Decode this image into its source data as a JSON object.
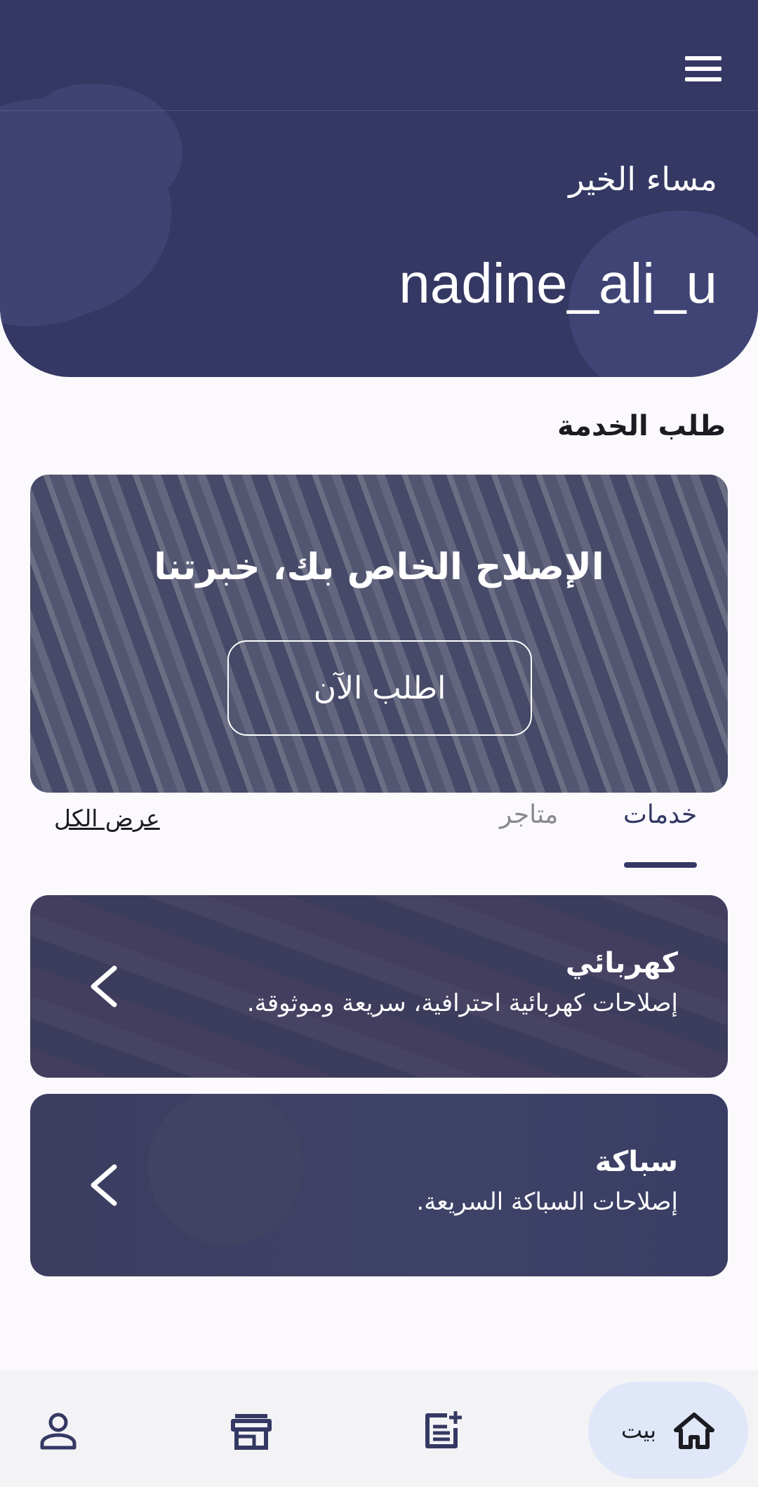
{
  "header": {
    "greeting": "مساء الخير",
    "username": "nadine_ali_u"
  },
  "section_title": "طلب الخدمة",
  "hero": {
    "title": "الإصلاح الخاص بك، خبرتنا",
    "button_label": "اطلب الآن"
  },
  "tabs": {
    "services": "خدمات",
    "stores": "متاجر",
    "view_all": "عرض الكل"
  },
  "services": [
    {
      "title": "كهربائي",
      "description": "إصلاحات كهربائية احترافية، سريعة وموثوقة."
    },
    {
      "title": "سباكة",
      "description": "إصلاحات السباكة السريعة."
    }
  ],
  "bottom_nav": {
    "home_label": "بيت",
    "icons": [
      "home-icon",
      "add-order-icon",
      "store-icon",
      "profile-icon"
    ]
  },
  "colors": {
    "primary": "#343863",
    "background": "#fbf9fc",
    "home_pill": "#dfe7f8"
  }
}
